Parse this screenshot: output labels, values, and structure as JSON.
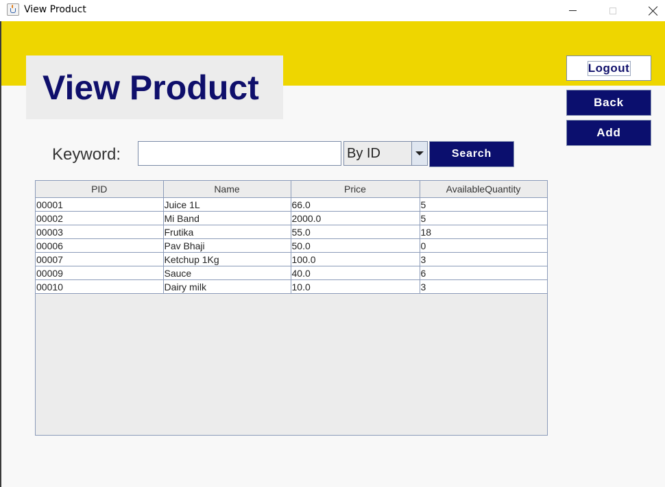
{
  "window": {
    "title": "View Product",
    "icon": "java-coffee-cup-icon"
  },
  "header": {
    "title": "View Product",
    "banner_color": "#eed600",
    "title_color": "#0f0f6b"
  },
  "buttons": {
    "logout": "Logout",
    "back": "Back",
    "add": "Add",
    "search": "Search",
    "dark_button_color": "#0b0f6e"
  },
  "search": {
    "keyword_label": "Keyword:",
    "keyword_value": "",
    "filter_selected": "By ID"
  },
  "table": {
    "columns": [
      "PID",
      "Name",
      "Price",
      "AvailableQuantity"
    ],
    "rows": [
      [
        "00001",
        "Juice 1L",
        "66.0",
        "5"
      ],
      [
        "00002",
        "Mi Band",
        "2000.0",
        "5"
      ],
      [
        "00003",
        "Frutika",
        "55.0",
        "18"
      ],
      [
        "00006",
        "Pav Bhaji",
        "50.0",
        "0"
      ],
      [
        "00007",
        "Ketchup 1Kg",
        "100.0",
        "3"
      ],
      [
        "00009",
        "Sauce",
        "40.0",
        "6"
      ],
      [
        "00010",
        "Dairy milk",
        "10.0",
        "3"
      ]
    ]
  }
}
